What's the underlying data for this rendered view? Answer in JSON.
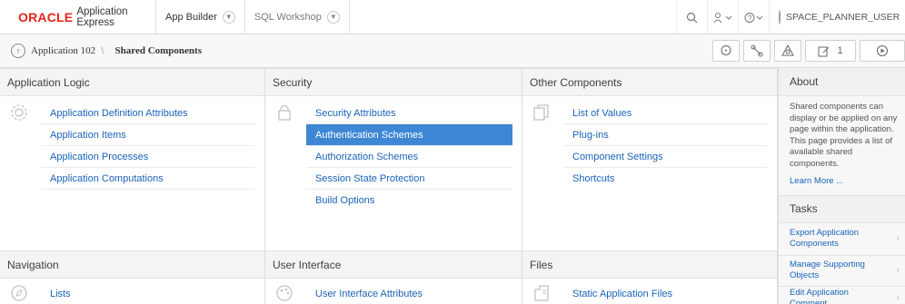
{
  "header": {
    "brand_oracle": "ORACLE",
    "brand_product": "Application Express",
    "tabs": [
      {
        "label": "App Builder"
      },
      {
        "label": "SQL Workshop"
      }
    ],
    "user": "SPACE_PLANNER_USER"
  },
  "breadcrumb": {
    "items": [
      "Application 102",
      "Shared Components"
    ]
  },
  "toolbar": {
    "edit_count": "1"
  },
  "regions": {
    "application_logic": {
      "title": "Application Logic",
      "links": [
        "Application Definition Attributes",
        "Application Items",
        "Application Processes",
        "Application Computations"
      ]
    },
    "security": {
      "title": "Security",
      "links": [
        "Security Attributes",
        "Authentication Schemes",
        "Authorization Schemes",
        "Session State Protection",
        "Build Options"
      ]
    },
    "other_components": {
      "title": "Other Components",
      "links": [
        "List of Values",
        "Plug-ins",
        "Component Settings",
        "Shortcuts"
      ]
    },
    "navigation": {
      "title": "Navigation",
      "links": [
        "Lists"
      ]
    },
    "user_interface": {
      "title": "User Interface",
      "links": [
        "User Interface Attributes"
      ]
    },
    "files": {
      "title": "Files",
      "links": [
        "Static Application Files"
      ]
    }
  },
  "sidebar": {
    "about_title": "About",
    "about_text": "Shared components can display or be applied on any page within the application. This page provides a list of available shared components.",
    "learn_more": "Learn More ...",
    "tasks_title": "Tasks",
    "tasks": [
      "Export Application Components",
      "Manage Supporting Objects",
      "Edit Application Comment"
    ]
  },
  "colors": {
    "oracle_red": "#e8231b",
    "link_blue": "#1a63b8",
    "selected_bg": "#3d87d4"
  }
}
